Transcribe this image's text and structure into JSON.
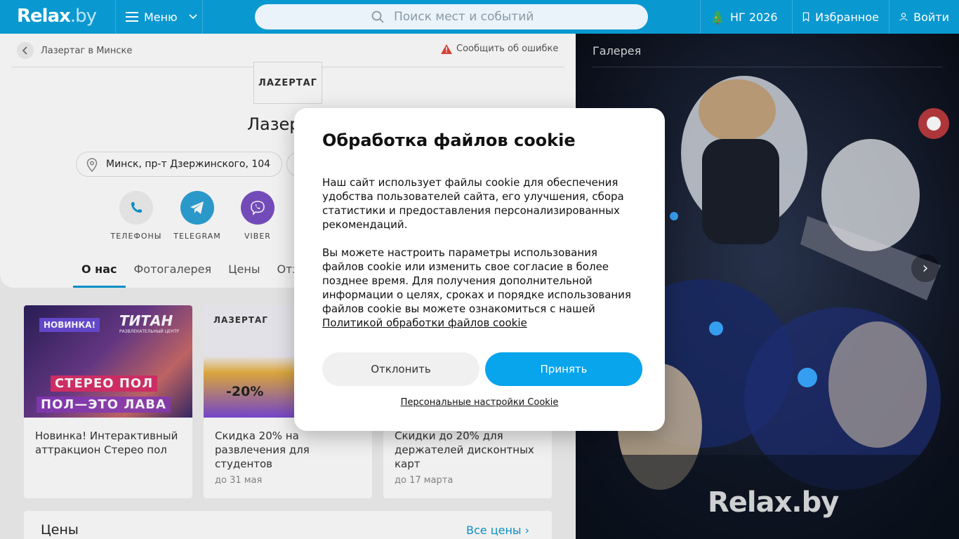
{
  "header": {
    "logo": "Relax",
    "logo_suffix": ".by",
    "menu_label": "Меню",
    "search_placeholder": "Поиск мест и событий",
    "ny_label": "НГ 2026",
    "favorites_label": "Избранное",
    "login_label": "Войти"
  },
  "page": {
    "breadcrumb": "Лазертаг в Минске",
    "report_label": "Сообщить об ошибке",
    "venue_logo_text": "ЛАZЕРТАГ",
    "venue_title": "Лазер",
    "address": "Минск, пр-т Дзержинского, 104",
    "contacts": [
      {
        "label": "ТЕЛЕФОНЫ",
        "icon": "phone-icon"
      },
      {
        "label": "TELEGRAM",
        "icon": "telegram-icon"
      },
      {
        "label": "VIBER",
        "icon": "viber-icon"
      }
    ],
    "tabs": [
      "О нас",
      "Фотогалерея",
      "Цены",
      "Отзы"
    ]
  },
  "promos": [
    {
      "title": "Новинка! Интерактивный аттракцион Стерео пол",
      "date": "",
      "badge": "НОВИНКА!",
      "brand": "ТИТАН",
      "brand_sub": "РАЗВЛЕКАТЕЛЬНЫЙ ЦЕНТР",
      "line1": "СТЕРЕО ПОЛ",
      "line2": "ПОЛ—ЭТО ЛАВА"
    },
    {
      "title": "Скидка 20% на развлечения для студентов",
      "date": "до 31 мая",
      "tag": "ЛАЗЕРТАГ",
      "discount": "-20%"
    },
    {
      "title": "Скидки до 20% для держателей дисконтных карт",
      "date": "до 17 марта"
    }
  ],
  "prices": {
    "title": "Цены",
    "all_link": "Все цены"
  },
  "gallery": {
    "title": "Галерея",
    "watermark": "Relax.by"
  },
  "cookie": {
    "title": "Обработка файлов cookie",
    "para1": "Наш сайт использует файлы cookie для обеспечения удобства пользователей сайта, его улучшения, сбора статистики и предоставления персонализированных рекомендаций.",
    "para2": "Вы можете настроить параметры использования файлов cookie или изменить свое согласие в более позднее время. Для получения дополнительной информации о целях, сроках и порядке использования файлов cookie вы можете ознакомиться с нашей",
    "policy_link": "Политикой обработки файлов cookie",
    "decline_label": "Отклонить",
    "accept_label": "Принять",
    "settings_link": "Персональные настройки Cookie"
  },
  "colors": {
    "brand": "#0a98d0",
    "accept": "#08a4ec",
    "telegram": "#2ea2d7",
    "viber": "#7b50c4"
  }
}
